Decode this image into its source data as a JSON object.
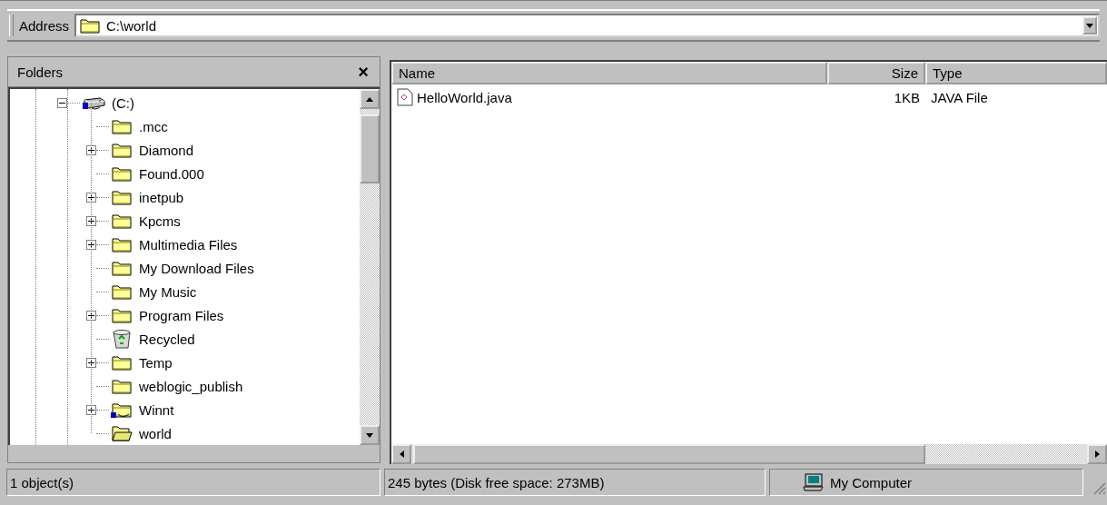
{
  "address_bar": {
    "label": "Address",
    "value": "C:\\world"
  },
  "folders_pane": {
    "title": "Folders",
    "close": "×",
    "tree": [
      {
        "label": "(C:)",
        "kind": "drive",
        "expanded": true,
        "children": [
          {
            "label": ".mcc",
            "kind": "folder"
          },
          {
            "label": "Diamond",
            "kind": "folder",
            "expanded": false
          },
          {
            "label": "Found.000",
            "kind": "folder"
          },
          {
            "label": "inetpub",
            "kind": "folder",
            "expanded": false
          },
          {
            "label": "Kpcms",
            "kind": "folder",
            "expanded": false
          },
          {
            "label": "Multimedia Files",
            "kind": "folder",
            "expanded": false
          },
          {
            "label": "My Download Files",
            "kind": "folder"
          },
          {
            "label": "My Music",
            "kind": "folder"
          },
          {
            "label": "Program Files",
            "kind": "folder",
            "expanded": false
          },
          {
            "label": "Recycled",
            "kind": "recycle"
          },
          {
            "label": "Temp",
            "kind": "folder",
            "expanded": false
          },
          {
            "label": "weblogic_publish",
            "kind": "folder"
          },
          {
            "label": "Winnt",
            "kind": "system_folder",
            "expanded": false
          },
          {
            "label": "world",
            "kind": "open_folder"
          }
        ]
      }
    ]
  },
  "file_list": {
    "columns": [
      "Name",
      "Size",
      "Type"
    ],
    "rows": [
      {
        "name": "HelloWorld.java",
        "size": "1KB",
        "type": "JAVA File"
      }
    ]
  },
  "status_bar": {
    "objects": "1 object(s)",
    "details": "245 bytes (Disk free space: 273MB)",
    "zone": "My Computer"
  }
}
